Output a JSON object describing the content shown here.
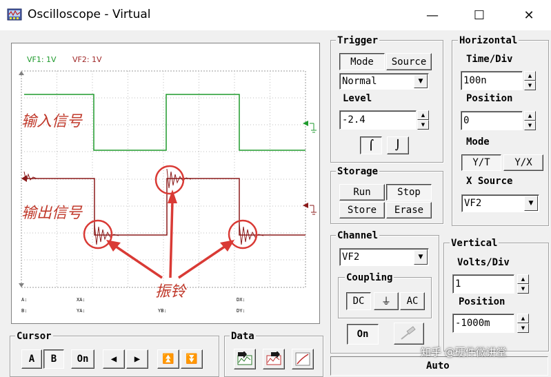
{
  "window": {
    "title": "Oscilloscope - Virtual",
    "minimize": "—",
    "maximize": "☐",
    "close": "✕"
  },
  "scope": {
    "vf1_label": "VF1: 1V",
    "vf2_label": "VF2: 1V",
    "annotation_input": "输入信号",
    "annotation_output": "输出信号",
    "annotation_ringing": "振铃",
    "readouts": {
      "a": "A:",
      "b": "B:",
      "xa": "XA:",
      "ya": "YA:",
      "yb": "YB:",
      "dx": "DX:",
      "dy": "DY:"
    },
    "colors": {
      "vf1": "#1e9a2c",
      "vf2": "#8b1a1a",
      "annotation": "#d93a35"
    }
  },
  "trigger": {
    "title": "Trigger",
    "mode_button": "Mode",
    "source_button": "Source",
    "mode_value": "Normal",
    "level_label": "Level",
    "level_value": "-2.4",
    "rising_edge": "⌠",
    "falling_edge": "⌡"
  },
  "horizontal": {
    "title": "Horizontal",
    "time_div_label": "Time/Div",
    "time_div_value": "100n",
    "position_label": "Position",
    "position_value": "0",
    "mode_label": "Mode",
    "yt_button": "Y/T",
    "yx_button": "Y/X",
    "x_source_label": "X Source",
    "x_source_value": "VF2"
  },
  "storage": {
    "title": "Storage",
    "run": "Run",
    "stop": "Stop",
    "store": "Store",
    "erase": "Erase"
  },
  "channel": {
    "title": "Channel",
    "value": "VF2",
    "coupling_title": "Coupling",
    "dc": "DC",
    "gnd": "⏚",
    "ac": "AC",
    "on_button": "On"
  },
  "vertical": {
    "title": "Vertical",
    "volts_div_label": "Volts/Div",
    "volts_div_value": "1",
    "position_label": "Position",
    "position_value": "-1000m"
  },
  "cursor": {
    "title": "Cursor",
    "a": "A",
    "b": "B",
    "on": "On"
  },
  "data": {
    "title": "Data"
  },
  "status": {
    "mode": "Auto",
    "watermark": "知乎 @硬件微讲堂"
  }
}
